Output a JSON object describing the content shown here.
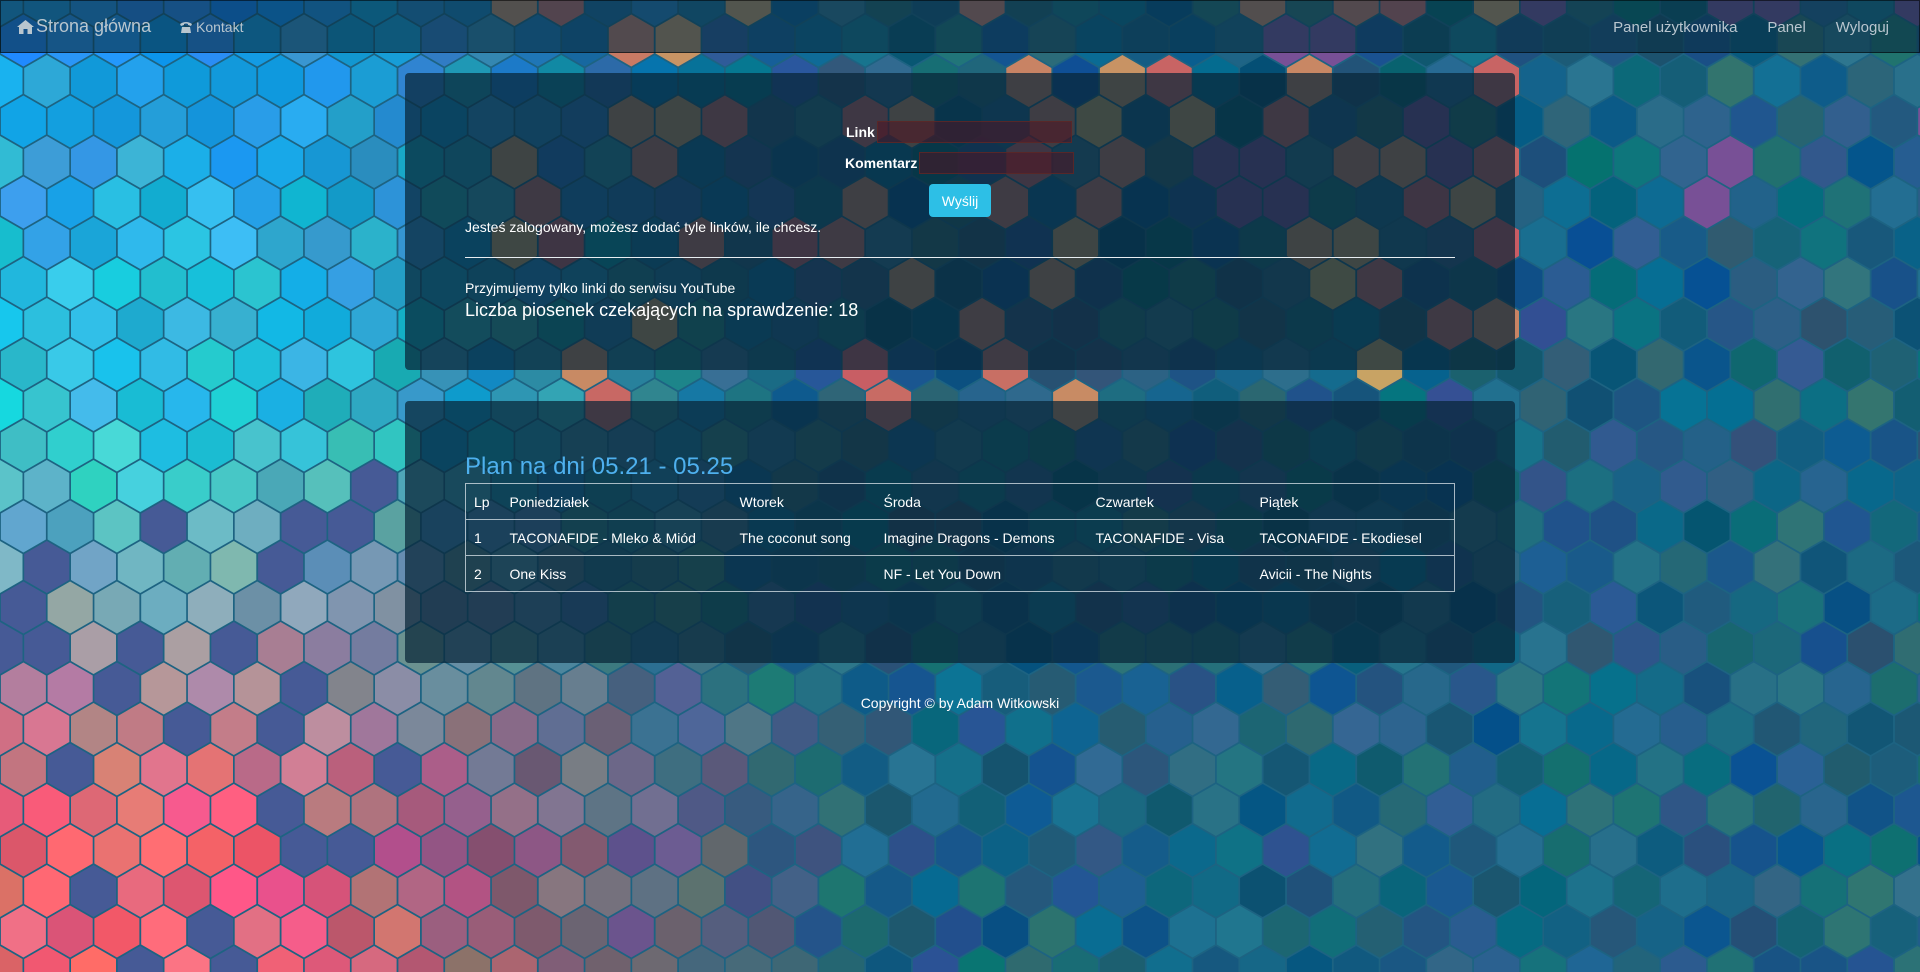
{
  "navbar": {
    "brand": "Strona główna",
    "brand_icon": "home-icon",
    "contact": "Kontakt",
    "contact_icon": "phone-icon",
    "user_panel": "Panel użytkownika",
    "panel": "Panel",
    "logout": "Wyloguj"
  },
  "form": {
    "link_label": "Link",
    "link_value": "",
    "comment_label": "Komentarz",
    "comment_value": "",
    "submit": "Wyślij",
    "logged_in_msg": "Jesteś zalogowany, możesz dodać tyle linków, ile chcesz.",
    "youtube_only": "Przyjmujemy tylko linki do serwisu YouTube",
    "pending_count": "Liczba piosenek czekających na sprawdzenie: 18"
  },
  "plan": {
    "title": "Plan na dni 05.21 - 05.25",
    "headers": [
      "Lp",
      "Poniedziałek",
      "Wtorek",
      "Środa",
      "Czwartek",
      "Piątek"
    ],
    "rows": [
      [
        "1",
        "TACONAFIDE - Mleko & Miód",
        "The coconut song",
        "Imagine Dragons - Demons",
        "TACONAFIDE - Visa",
        "TACONAFIDE - Ekodiesel"
      ],
      [
        "2",
        "One Kiss",
        "",
        "NF - Let You Down",
        "",
        "Avicii - The Nights"
      ]
    ]
  },
  "footer": {
    "text": "Copyright © by Adam Witkowski"
  },
  "colors": {
    "background": "#1d6382",
    "accent": "#2dbfe6",
    "title": "#4eb0ee"
  }
}
